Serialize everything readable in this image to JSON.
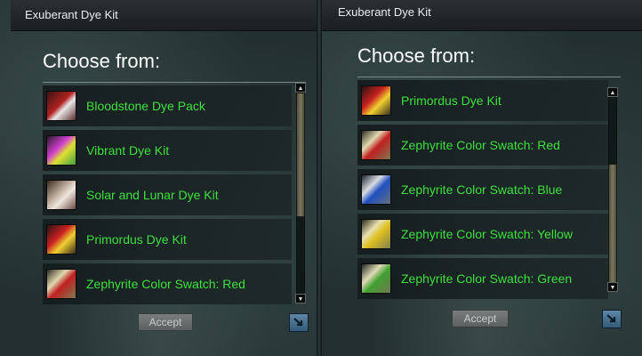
{
  "left_window": {
    "title": "Exuberant Dye Kit",
    "prompt": "Choose from:",
    "items": [
      {
        "label": "Bloodstone Dye Pack",
        "icon": "bloodstone-dye-pack-icon"
      },
      {
        "label": "Vibrant Dye Kit",
        "icon": "vibrant-dye-kit-icon"
      },
      {
        "label": "Solar and Lunar Dye Kit",
        "icon": "solar-lunar-dye-kit-icon"
      },
      {
        "label": "Primordus Dye Kit",
        "icon": "primordus-dye-kit-icon"
      },
      {
        "label": "Zephyrite Color Swatch: Red",
        "icon": "zephyrite-swatch-red-icon"
      }
    ],
    "scroll_position": 0.0,
    "accept_label": "Accept",
    "accept_enabled": false
  },
  "right_window": {
    "title": "Exuberant Dye Kit",
    "prompt": "Choose from:",
    "items": [
      {
        "label": "Primordus Dye Kit",
        "icon": "primordus-dye-kit-icon"
      },
      {
        "label": "Zephyrite Color Swatch: Red",
        "icon": "zephyrite-swatch-red-icon"
      },
      {
        "label": "Zephyrite Color Swatch: Blue",
        "icon": "zephyrite-swatch-blue-icon"
      },
      {
        "label": "Zephyrite Color Swatch: Yellow",
        "icon": "zephyrite-swatch-yellow-icon"
      },
      {
        "label": "Zephyrite Color Swatch: Green",
        "icon": "zephyrite-swatch-green-icon"
      }
    ],
    "scroll_position": 1.0,
    "accept_label": "Accept",
    "accept_enabled": false
  },
  "colors": {
    "item_text": "#3ee03e",
    "title_text": "#e8ecec",
    "prompt_text": "#ffffff",
    "button_bg": "#6d7070"
  }
}
